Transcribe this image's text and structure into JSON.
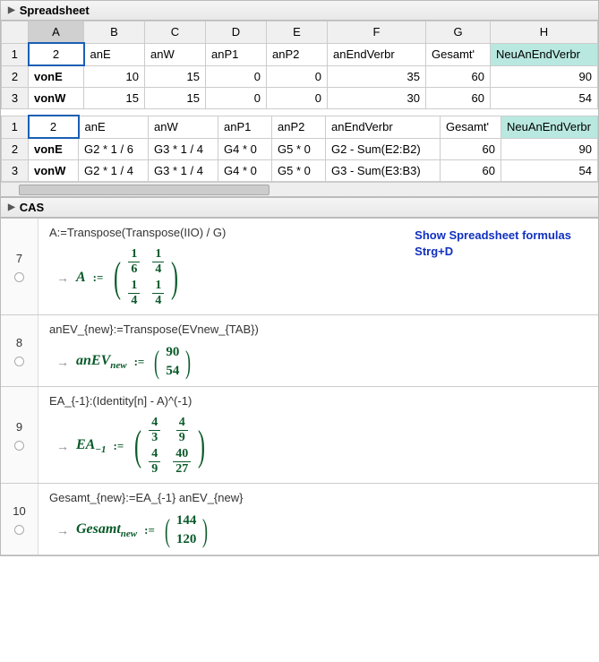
{
  "panels": {
    "spreadsheet": "Spreadsheet",
    "cas": "CAS"
  },
  "sheet": {
    "cols": [
      "A",
      "B",
      "C",
      "D",
      "E",
      "F",
      "G",
      "H"
    ],
    "sel": "2",
    "headers": [
      "anE",
      "anW",
      "anP1",
      "anP2",
      "anEndVerbr",
      "Gesamt'",
      "NeuAnEndVerbr"
    ],
    "rows": [
      {
        "lbl": "vonE",
        "vals": [
          "10",
          "15",
          "0",
          "0",
          "35",
          "60",
          "90"
        ]
      },
      {
        "lbl": "vonW",
        "vals": [
          "15",
          "15",
          "0",
          "0",
          "30",
          "60",
          "54"
        ]
      }
    ],
    "frows": [
      {
        "lbl": "vonE",
        "vals": [
          "G2 * 1 / 6",
          "G3 * 1 / 4",
          "G4 * 0",
          "G5 * 0",
          "G2 - Sum(E2:B2)",
          "60",
          "90"
        ]
      },
      {
        "lbl": "vonW",
        "vals": [
          "G2 * 1 / 4",
          "G3 * 1 / 4",
          "G4 * 0",
          "G5 * 0",
          "G3 - Sum(E3:B3)",
          "60",
          "54"
        ]
      }
    ]
  },
  "note": {
    "l1": "Show Spreadsheet formulas",
    "l2": "Strg+D"
  },
  "cas": [
    {
      "n": "7",
      "in": "A:=Transpose(Transpose(IIO) / G)",
      "var": "A",
      "mtype": "frac2x2",
      "m": [
        [
          "1",
          "6"
        ],
        [
          "1",
          "4"
        ],
        [
          "1",
          "4"
        ],
        [
          "1",
          "4"
        ]
      ]
    },
    {
      "n": "8",
      "in": "anEV_{new}:=Transpose(EVnew_{TAB})",
      "var": "anEV",
      "sub": "new",
      "mtype": "col2",
      "m": [
        "90",
        "54"
      ]
    },
    {
      "n": "9",
      "in": "EA_{-1}:(Identity[n] - A)^(-1)",
      "var": "EA",
      "sub": "−1",
      "mtype": "frac2x2",
      "m": [
        [
          "4",
          "3"
        ],
        [
          "4",
          "9"
        ],
        [
          "4",
          "9"
        ],
        [
          "40",
          "27"
        ]
      ]
    },
    {
      "n": "10",
      "in": "Gesamt_{new}:=EA_{-1} anEV_{new}",
      "var": "Gesamt",
      "sub": "new",
      "mtype": "col2",
      "m": [
        "144",
        "120"
      ]
    }
  ],
  "chart_data": {
    "type": "table",
    "title": "Spreadsheet values",
    "columns": [
      "",
      "anE",
      "anW",
      "anP1",
      "anP2",
      "anEndVerbr",
      "Gesamt'",
      "NeuAnEndVerbr"
    ],
    "rows": [
      [
        "vonE",
        10,
        15,
        0,
        0,
        35,
        60,
        90
      ],
      [
        "vonW",
        15,
        15,
        0,
        0,
        30,
        60,
        54
      ]
    ],
    "cas_results": {
      "A": [
        [
          0.1667,
          0.25
        ],
        [
          0.25,
          0.25
        ]
      ],
      "anEV_new": [
        90,
        54
      ],
      "EA_minus1": [
        [
          1.3333,
          0.4444
        ],
        [
          0.4444,
          1.4815
        ]
      ],
      "Gesamt_new": [
        144,
        120
      ]
    }
  }
}
